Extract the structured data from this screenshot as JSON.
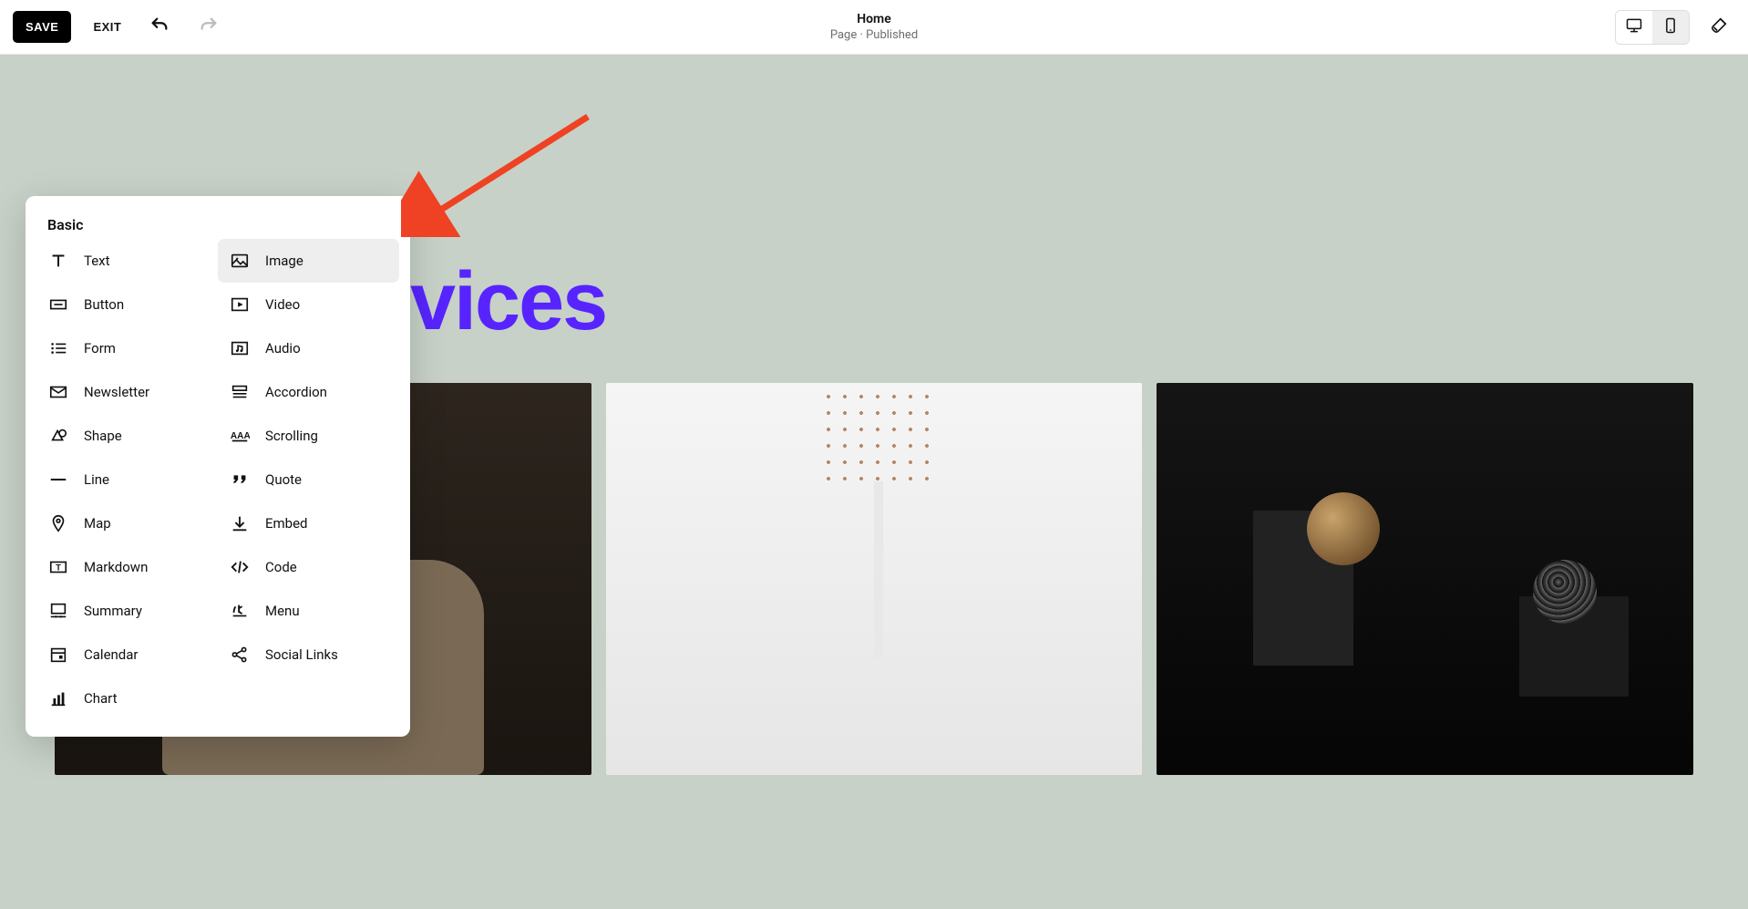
{
  "topbar": {
    "save_label": "SAVE",
    "exit_label": "EXIT"
  },
  "page": {
    "title": "Home",
    "subtitle": "Page · Published"
  },
  "hero": {
    "text": "vices"
  },
  "panel": {
    "title": "Basic",
    "blocks_col1": [
      {
        "label": "Text",
        "icon": "text-icon"
      },
      {
        "label": "Button",
        "icon": "button-icon"
      },
      {
        "label": "Form",
        "icon": "form-icon"
      },
      {
        "label": "Newsletter",
        "icon": "newsletter-icon"
      },
      {
        "label": "Shape",
        "icon": "shape-icon"
      },
      {
        "label": "Line",
        "icon": "line-icon"
      },
      {
        "label": "Map",
        "icon": "map-icon"
      },
      {
        "label": "Markdown",
        "icon": "markdown-icon"
      },
      {
        "label": "Summary",
        "icon": "summary-icon"
      },
      {
        "label": "Calendar",
        "icon": "calendar-icon"
      },
      {
        "label": "Chart",
        "icon": "chart-icon"
      }
    ],
    "blocks_col2": [
      {
        "label": "Image",
        "icon": "image-icon",
        "hovered": true
      },
      {
        "label": "Video",
        "icon": "video-icon"
      },
      {
        "label": "Audio",
        "icon": "audio-icon"
      },
      {
        "label": "Accordion",
        "icon": "accordion-icon"
      },
      {
        "label": "Scrolling",
        "icon": "scrolling-icon"
      },
      {
        "label": "Quote",
        "icon": "quote-icon"
      },
      {
        "label": "Embed",
        "icon": "embed-icon"
      },
      {
        "label": "Code",
        "icon": "code-icon"
      },
      {
        "label": "Menu",
        "icon": "menu-icon"
      },
      {
        "label": "Social Links",
        "icon": "social-icon"
      }
    ]
  }
}
